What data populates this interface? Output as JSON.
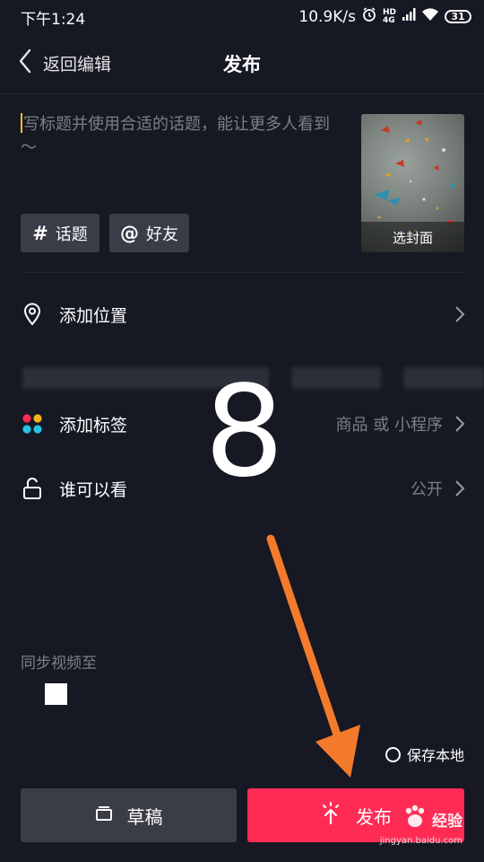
{
  "status_bar": {
    "time": "下午1:24",
    "net_speed": "10.9K/s",
    "hd_label_top": "HD",
    "hd_label_bottom": "4G",
    "battery": "31",
    "icons": [
      "alarm-icon",
      "signal-icon",
      "wifi-icon",
      "battery-icon"
    ]
  },
  "header": {
    "back_label": "返回编辑",
    "title": "发布"
  },
  "caption": {
    "placeholder": "写标题并使用合适的话题，能让更多人看到～"
  },
  "cover": {
    "label": "选封面"
  },
  "chips": {
    "topic_symbol": "#",
    "topic_label": "话题",
    "friend_symbol": "@",
    "friend_label": "好友"
  },
  "options": {
    "location_label": "添加位置",
    "tag_label": "添加标签",
    "tag_value": "商品 或 小程序",
    "visibility_label": "谁可以看",
    "visibility_value": "公开"
  },
  "annotation": {
    "step_number": "8",
    "arrow_color": "#f47a2c"
  },
  "sync": {
    "label": "同步视频至"
  },
  "save_local": {
    "label": "保存本地"
  },
  "actions": {
    "draft_label": "草稿",
    "publish_label": "发布"
  },
  "watermark": {
    "brand": "经验",
    "url": "jingyan.baidu.com"
  },
  "colors": {
    "background": "#161823",
    "accent": "#fe2c55",
    "secondary_button": "#3a3c47",
    "muted_text": "#7d7f87"
  }
}
